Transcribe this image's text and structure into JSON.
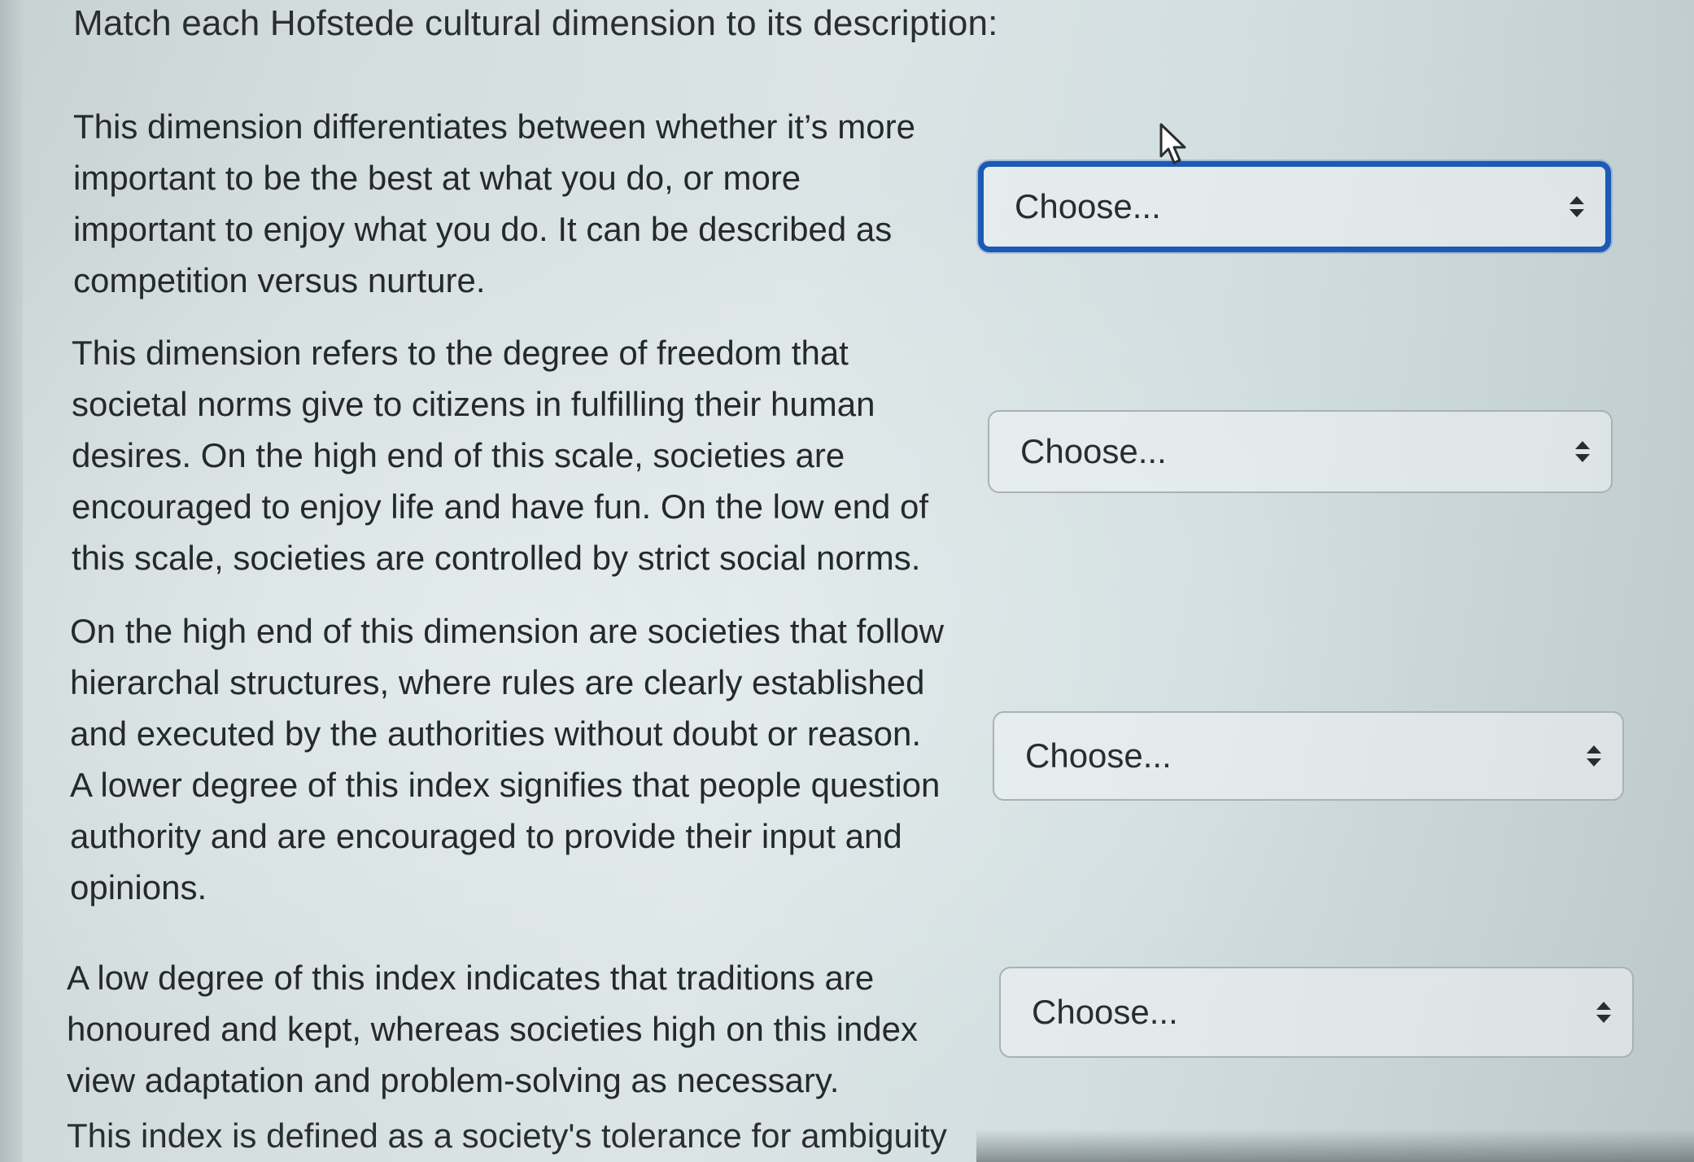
{
  "instructions": "Match each Hofstede cultural dimension to its description:",
  "questions": [
    {
      "lines": [
        "This dimension differentiates between whether it’s more",
        "important to be the best at what you do, or more",
        "important to enjoy what you do. It can be described as",
        "competition versus nurture."
      ],
      "select_value": "Choose..."
    },
    {
      "lines": [
        "This dimension refers to the degree of freedom that",
        "societal norms give to citizens in fulfilling their human",
        "desires. On the high end of this scale, societies are",
        "encouraged to enjoy life and have fun. On the low end of",
        "this scale, societies are controlled by strict social norms."
      ],
      "select_value": "Choose..."
    },
    {
      "lines": [
        "On the high end of this dimension are societies that follow",
        "hierarchal structures, where rules are clearly established",
        "and executed by the authorities without doubt or reason.",
        "A lower degree of this index signifies that people question",
        "authority and are encouraged to provide their input and",
        "opinions."
      ],
      "select_value": "Choose..."
    },
    {
      "lines": [
        "A low degree of this index indicates that traditions are",
        "honoured and kept, whereas societies high on this index",
        "view adaptation and problem-solving as necessary."
      ],
      "select_value": "Choose..."
    }
  ],
  "partial_question": "This index is defined as a society's tolerance for ambiguity",
  "colors": {
    "focus_border": "#1c5ab6",
    "text": "#26292c",
    "select_border": "#a9b1b6"
  },
  "icons": {
    "select_arrows": "updown-chevron-icon",
    "cursor": "mouse-pointer-icon"
  }
}
